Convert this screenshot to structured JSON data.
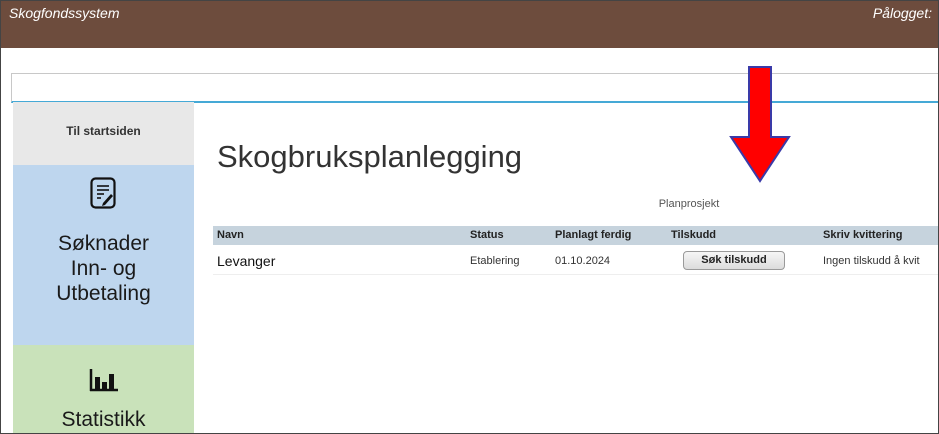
{
  "header": {
    "app_title": "Skogfondssystem",
    "login_label": "Pålogget:",
    "background_color": "#6d4c3d"
  },
  "sidebar": {
    "home_label": "Til startsiden",
    "items": [
      {
        "label_lines": [
          "Søknader",
          "Inn- og",
          "Utbetaling"
        ],
        "icon": "document-edit-icon",
        "color": "#bed6ee"
      },
      {
        "label_lines": [
          "Statistikk"
        ],
        "icon": "bar-chart-icon",
        "color": "#c9e2ba"
      }
    ]
  },
  "main": {
    "title": "Skogbruksplanlegging",
    "group_header": "Planprosjekt",
    "columns": [
      "Navn",
      "Status",
      "Planlagt ferdig",
      "Tilskudd",
      "Skriv kvittering"
    ],
    "rows": [
      {
        "navn": "Levanger",
        "status": "Etablering",
        "planlagt_ferdig": "01.10.2024",
        "tilskudd_button": "Søk tilskudd",
        "kvittering": "Ingen tilskudd å kvit"
      }
    ]
  },
  "annotation": {
    "icon": "red-arrow-down-icon",
    "color": "#ff0000"
  }
}
